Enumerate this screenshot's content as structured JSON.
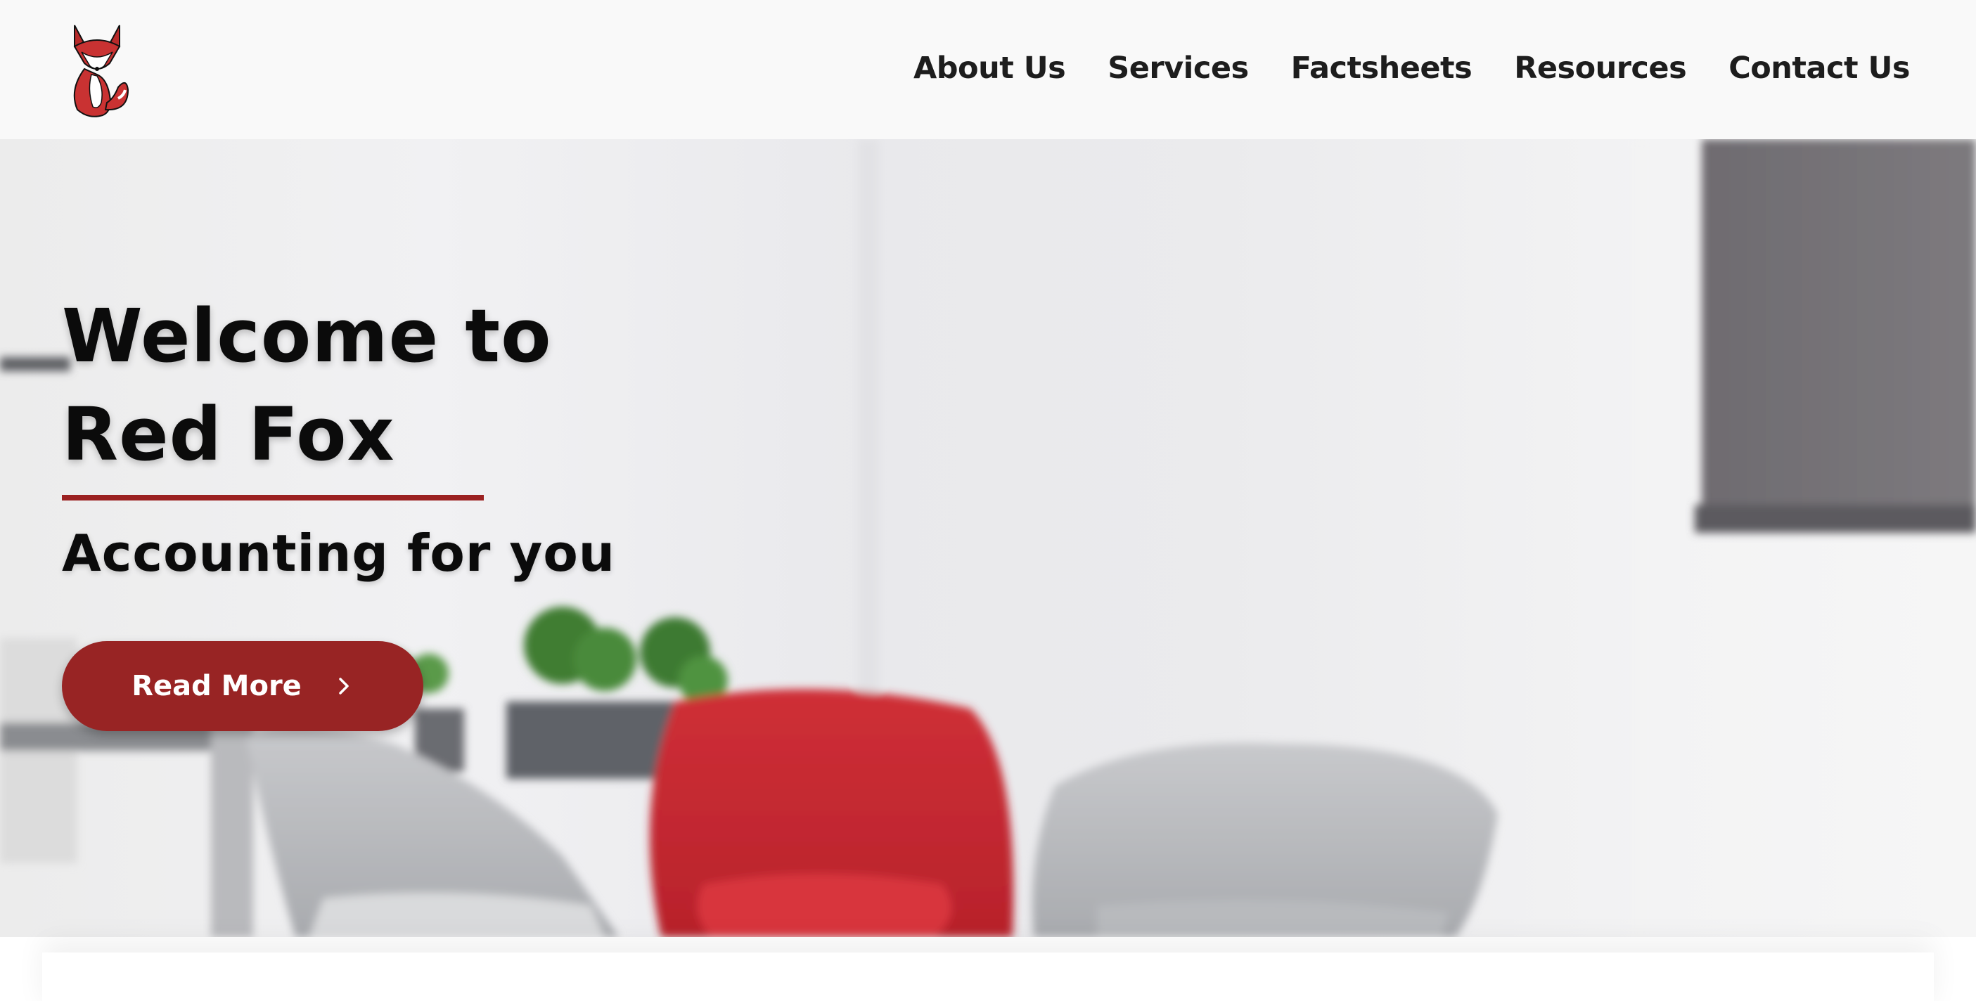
{
  "header": {
    "logo_alt": "Red Fox logo",
    "nav": [
      {
        "label": "About Us"
      },
      {
        "label": "Services"
      },
      {
        "label": "Factsheets"
      },
      {
        "label": "Resources"
      },
      {
        "label": "Contact Us"
      }
    ]
  },
  "hero": {
    "title_line1": "Welcome to",
    "title_line2": "Red Fox",
    "subtitle": "Accounting for you",
    "cta_label": "Read More",
    "cta_icon": "chevron-right-icon"
  },
  "colors": {
    "brand_red": "#982424",
    "chair_red": "#c62b33",
    "header_bg": "#f9f9f9"
  }
}
